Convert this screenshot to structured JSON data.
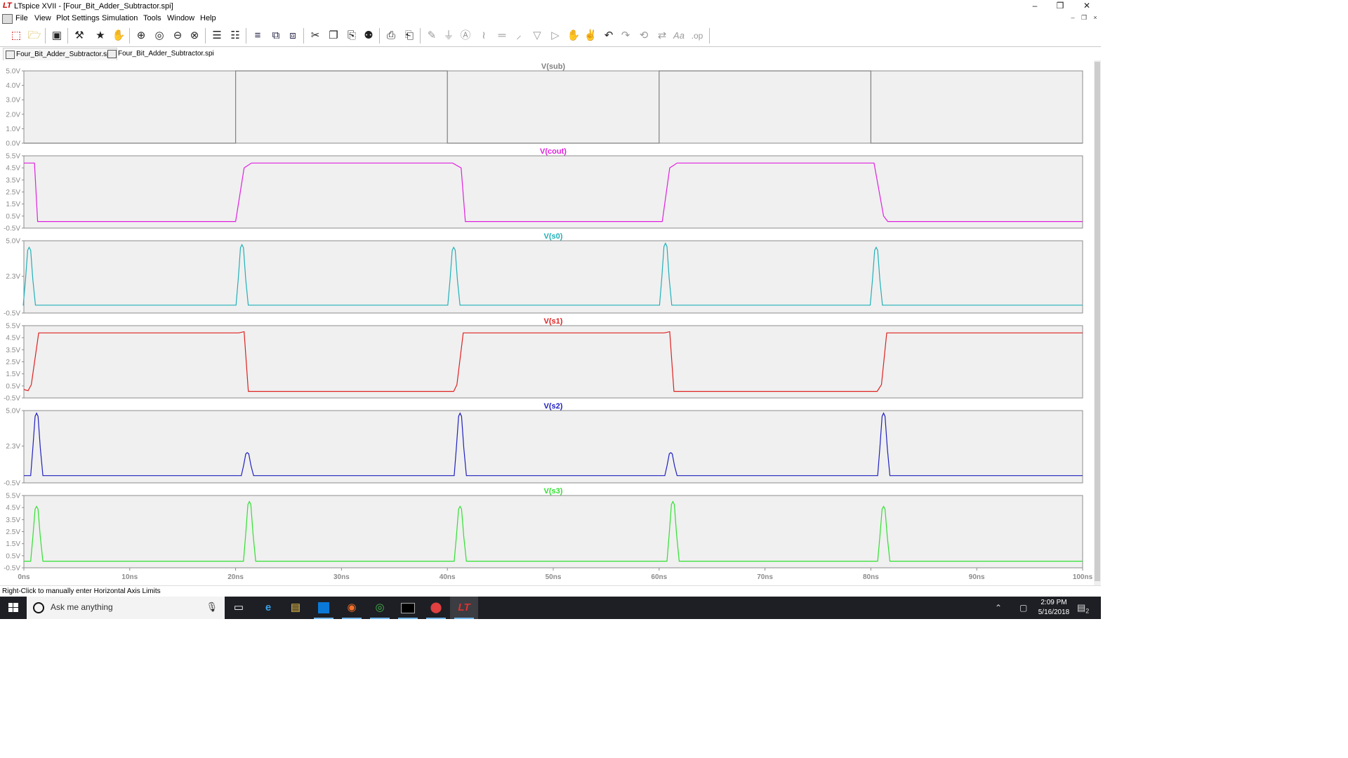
{
  "window": {
    "title": "LTspice XVII - [Four_Bit_Adder_Subtractor.spi]",
    "app_icon": "ltspice-icon",
    "controls": [
      "–",
      "❒",
      "✕"
    ]
  },
  "menu": {
    "items": [
      "File",
      "View",
      "Plot Settings",
      "Simulation",
      "Tools",
      "Window",
      "Help"
    ],
    "mdi_controls": [
      "–",
      "❐",
      "×"
    ]
  },
  "toolbar": {
    "icons": [
      "new-schematic-icon",
      "open-icon",
      "save-icon",
      "control-panel-icon",
      "run-icon",
      "pan-hand-icon",
      "zoom-in-icon",
      "zoom-area-icon",
      "zoom-out-icon",
      "zoom-fit-icon",
      "autorange-icon",
      "zoom-extents-icon",
      "tile-horizontal-icon",
      "cascade-icon",
      "tile-vertical-icon",
      "cut-icon",
      "copy-icon",
      "paste-icon",
      "find-icon",
      "print-icon",
      "print-setup-icon",
      "draw-wire-icon",
      "ground-icon",
      "label-net-icon",
      "resistor-icon",
      "capacitor-icon",
      "inductor-icon",
      "diode-icon",
      "component-icon",
      "move-icon",
      "drag-icon",
      "undo-icon",
      "redo-icon",
      "rotate-icon",
      "mirror-icon",
      "text-icon",
      "spice-directive-icon"
    ]
  },
  "tabs": [
    {
      "label": "Four_Bit_Adder_Subtractor.spi",
      "icon": "waveform-icon"
    },
    {
      "label": "Four_Bit_Adder_Subtractor.spi",
      "icon": "netlist-icon"
    }
  ],
  "status": {
    "text": "Right-Click to manually enter Horizontal Axis Limits"
  },
  "taskbar": {
    "search_placeholder": "Ask me anything",
    "time": "2:09 PM",
    "date": "5/16/2018",
    "notification_count": "2",
    "apps": [
      "task-view-icon",
      "edge-icon",
      "file-explorer-icon",
      "store-icon",
      "firefox-icon",
      "chrome-icon",
      "terminal-icon",
      "app-icon",
      "ltspice-icon"
    ]
  },
  "chart_data": [
    {
      "type": "line",
      "title": "V(sub)",
      "color": "#808080",
      "xlim": [
        0,
        100
      ],
      "xunit": "ns",
      "ylim": [
        0,
        5
      ],
      "yticks": [
        "5.0V",
        "4.0V",
        "3.0V",
        "2.0V",
        "1.0V",
        "0.0V"
      ],
      "x": [
        0,
        20,
        20,
        40,
        40,
        60,
        60,
        80,
        80,
        100
      ],
      "y": [
        0,
        0,
        5,
        5,
        0,
        0,
        5,
        5,
        0,
        0
      ]
    },
    {
      "type": "line",
      "title": "V(cout)",
      "color": "#e020e0",
      "xlim": [
        0,
        100
      ],
      "xunit": "ns",
      "ylim": [
        -0.5,
        5.5
      ],
      "yticks": [
        "5.5V",
        "4.5V",
        "3.5V",
        "2.5V",
        "1.5V",
        "0.5V",
        "-0.5V"
      ],
      "x": [
        0,
        1,
        1.3,
        20,
        20.8,
        21.5,
        40.5,
        41.3,
        41.7,
        60.3,
        61,
        61.7,
        80.3,
        81.2,
        81.6,
        100
      ],
      "y": [
        4.9,
        4.9,
        0.05,
        0.05,
        4.5,
        4.9,
        4.9,
        4.5,
        0.05,
        0.05,
        4.5,
        4.9,
        4.9,
        0.5,
        0.05,
        0.05
      ]
    },
    {
      "type": "line",
      "title": "V(s0)",
      "color": "#20b0b8",
      "xlim": [
        0,
        100
      ],
      "xunit": "ns",
      "ylim": [
        -0.5,
        5.0
      ],
      "yticks": [
        "5.0V",
        "2.3V",
        "-0.5V"
      ],
      "x": [
        0,
        0.2,
        0.4,
        0.6,
        0.9,
        1.3,
        100
      ],
      "y": [
        0,
        1.5,
        4.4,
        4.6,
        2.5,
        0.1,
        0.1
      ],
      "peaks": [
        {
          "x": 0.5,
          "y": 4.5
        },
        {
          "x": 20.6,
          "y": 4.7
        },
        {
          "x": 40.6,
          "y": 4.5
        },
        {
          "x": 60.6,
          "y": 4.8
        },
        {
          "x": 80.5,
          "y": 4.5
        }
      ],
      "baseline": 0.1
    },
    {
      "type": "line",
      "title": "V(s1)",
      "color": "#e02020",
      "xlim": [
        0,
        100
      ],
      "xunit": "ns",
      "ylim": [
        -0.5,
        5.5
      ],
      "yticks": [
        "5.5V",
        "4.5V",
        "3.5V",
        "2.5V",
        "1.5V",
        "0.5V",
        "-0.5V"
      ],
      "x": [
        0,
        0.4,
        0.7,
        1.4,
        20.3,
        20.8,
        21.2,
        40.6,
        40.9,
        41.5,
        60.5,
        61.0,
        61.4,
        80.6,
        81.0,
        81.5,
        100
      ],
      "y": [
        0.2,
        0.1,
        0.6,
        4.9,
        4.9,
        5.0,
        0.05,
        0.05,
        0.6,
        4.9,
        4.9,
        5.0,
        0.05,
        0.05,
        0.6,
        4.9,
        4.9
      ]
    },
    {
      "type": "line",
      "title": "V(s2)",
      "color": "#2020c0",
      "xlim": [
        0,
        100
      ],
      "xunit": "ns",
      "ylim": [
        -0.5,
        5.0
      ],
      "yticks": [
        "5.0V",
        "2.3V",
        "-0.5V"
      ],
      "peaks": [
        {
          "x": 1.2,
          "y": 4.8
        },
        {
          "x": 21.1,
          "y": 1.8
        },
        {
          "x": 41.2,
          "y": 4.8
        },
        {
          "x": 61.1,
          "y": 1.8
        },
        {
          "x": 81.2,
          "y": 4.8
        }
      ],
      "baseline": 0.05
    },
    {
      "type": "line",
      "title": "V(s3)",
      "color": "#30e030",
      "xlim": [
        0,
        100
      ],
      "xunit": "ns",
      "ylim": [
        -0.5,
        5.5
      ],
      "yticks": [
        "5.5V",
        "4.5V",
        "3.5V",
        "2.5V",
        "1.5V",
        "0.5V",
        "-0.5V"
      ],
      "peaks": [
        {
          "x": 1.2,
          "y": 4.6
        },
        {
          "x": 21.3,
          "y": 5.0
        },
        {
          "x": 41.2,
          "y": 4.6
        },
        {
          "x": 61.3,
          "y": 5.0
        },
        {
          "x": 81.2,
          "y": 4.6
        }
      ],
      "baseline": 0.05
    }
  ],
  "x_axis": {
    "ticks": [
      "0ns",
      "10ns",
      "20ns",
      "30ns",
      "40ns",
      "50ns",
      "60ns",
      "70ns",
      "80ns",
      "90ns",
      "100ns"
    ],
    "values": [
      0,
      10,
      20,
      30,
      40,
      50,
      60,
      70,
      80,
      90,
      100
    ]
  }
}
